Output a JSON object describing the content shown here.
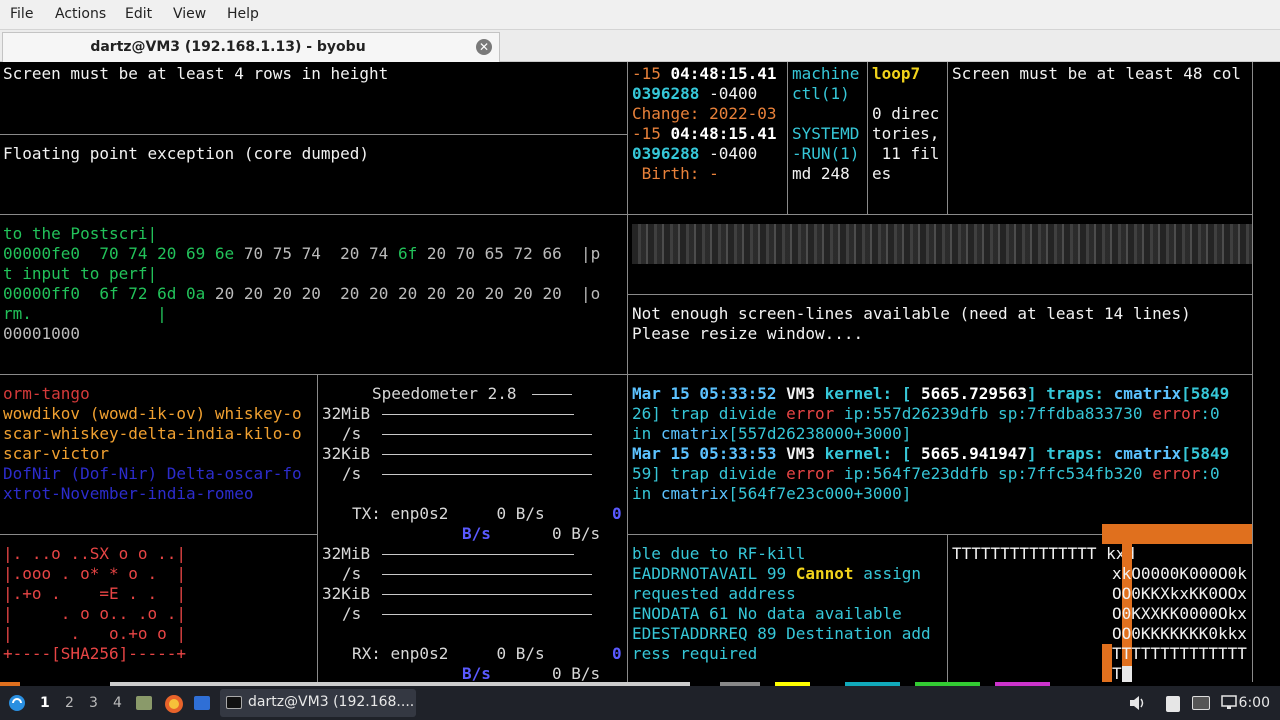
{
  "menubar": {
    "file": "File",
    "actions": "Actions",
    "edit": "Edit",
    "view": "View",
    "help": "Help"
  },
  "tab": {
    "title": "dartz@VM3 (192.168.1.13) - byobu",
    "close": "✕"
  },
  "terminal": {
    "p1": "Screen must be at least 4 rows in height",
    "p2": "Floating point exception (core dumped)",
    "hex": {
      "l1": "to the Postscri|",
      "l2a": "00000fe0  70 74 20 69 ",
      "l2b": "6e",
      "l2c": " 70 75 74  20 74 ",
      "l2d": "6f",
      "l2e": " 20 70 65 72 66  |p",
      "l3": "t input to perf|",
      "l4a": "00000ff0  6f 72 ",
      "l4b": "6d 0a",
      "l4c": " 20 20 20 20  20 20 20 20 20 20 20 20  |o",
      "l5": "rm.             |",
      "l6": "00001000"
    },
    "phon": {
      "l1": "orm-tango",
      "l2": "wowdikov (wowd-ik-ov) whiskey-o",
      "l3": "scar-whiskey-delta-india-kilo-o",
      "l4": "scar-victor",
      "l5": "DofNir (Dof-Nir) Delta-oscar-fo",
      "l6": "xtrot-November-india-romeo"
    },
    "art": {
      "l1": "|. ..o ..SX o o ..|",
      "l2": "|.ooo . o* * o .  |",
      "l3": "|.+o .    =E . .  |",
      "l4": "|     . o o.. .o .|",
      "l5": "|      .   o.+o o |",
      "l6": "+----[SHA256]-----+"
    },
    "speedo": {
      "title": "Speedometer 2.8",
      "s1": "32MiB",
      "ps1": "/s",
      "s2": "32KiB",
      "ps2": "/s",
      "tx": "TX: enp0s2     0 B/s",
      "txz": "0",
      "txbs": "B/s",
      "txbs2": "0 B/s",
      "s3": "32MiB",
      "ps3": "/s",
      "s4": "32KiB",
      "ps4": "/s",
      "rx": "RX: enp0s2     0 B/s",
      "rxz": "0",
      "rxbs": "B/s",
      "rxbs2": "0 B/s"
    },
    "stat": {
      "l1a": "-15 ",
      "l1b": "04:48:15.41",
      "l2a": "0396288",
      "l2b": " -0400",
      "l3": "Change: 2022-03",
      "l4a": "-15 ",
      "l4b": "04:48:15.41",
      "l5a": "0396288",
      "l5b": " -0400",
      "l6": " Birth: -"
    },
    "man": {
      "l1": "machine",
      "l2": "ctl(1)",
      "l4": "SYSTEMD",
      "l5": "-RUN(1)",
      "l6": "md 248"
    },
    "loop": {
      "l1": "loop7",
      "l3": "0 direc",
      "l4": "tories,",
      "l5": " 11 fil",
      "l6": "es"
    },
    "p_right": "Screen must be at least 48 col",
    "notenough": {
      "l1": "Not enough screen-lines available (need at least 14 lines)",
      "l2": "Please resize window...."
    },
    "kern": {
      "l1a": "Mar 15 05:33:52",
      "l1b": " VM3 ",
      "l1c": "kernel: [ ",
      "l1d": "5665.729563",
      "l1e": "] traps: ",
      "l1f": "cmatrix",
      "l1g": "[5849",
      "l2a": "26",
      "l2b": "] trap divide ",
      "l2c": "error",
      "l2d": " ip:557d26239dfb sp:7ffdba833730 ",
      "l2e": "error",
      "l2f": ":0",
      "l3a": "in ",
      "l3b": "cmatrix",
      "l3c": "[557d26238000+3000]",
      "l4a": "Mar 15 05:33:53",
      "l4b": " VM3 ",
      "l4c": "kernel: [ ",
      "l4d": "5665.941947",
      "l4e": "] traps: ",
      "l4f": "cmatrix",
      "l4g": "[5849",
      "l5a": "59",
      "l5b": "] trap divide ",
      "l5c": "error",
      "l5d": " ip:564f7e23ddfb sp:7ffc534fb320 ",
      "l5e": "error",
      "l5f": ":0",
      "l6a": "in ",
      "l6b": "cmatrix",
      "l6c": "[564f7e23c000+3000]"
    },
    "errno": {
      "l1": "ble due to RF-kill",
      "l2a": "EADDRNOTAVAIL 99 ",
      "l2b": "Cannot",
      "l2c": " assign",
      "l3": "requested address",
      "l4": "ENODATA 61 No data available",
      "l5": "EDESTADDRREQ 89 Destination add",
      "l6": "ress required"
    },
    "tt": {
      "l1": "TTTTTTTTTTTTTTT kxd"
    },
    "ko": {
      "l2": "xkO0000K000O0k",
      "l3": "OO0KKXkxKK0OOx",
      "l4": "O0KXXKK0000Okx",
      "l5": "OO0KKKKKKK0kkx",
      "l6": "TTTTTTTTTTTTTT",
      "l7": "T"
    }
  },
  "taskbar": {
    "ws1": "1",
    "ws2": "2",
    "ws3": "3",
    "ws4": "4",
    "task_title": "dartz@VM3 (192.168....",
    "clock": "6:00"
  }
}
